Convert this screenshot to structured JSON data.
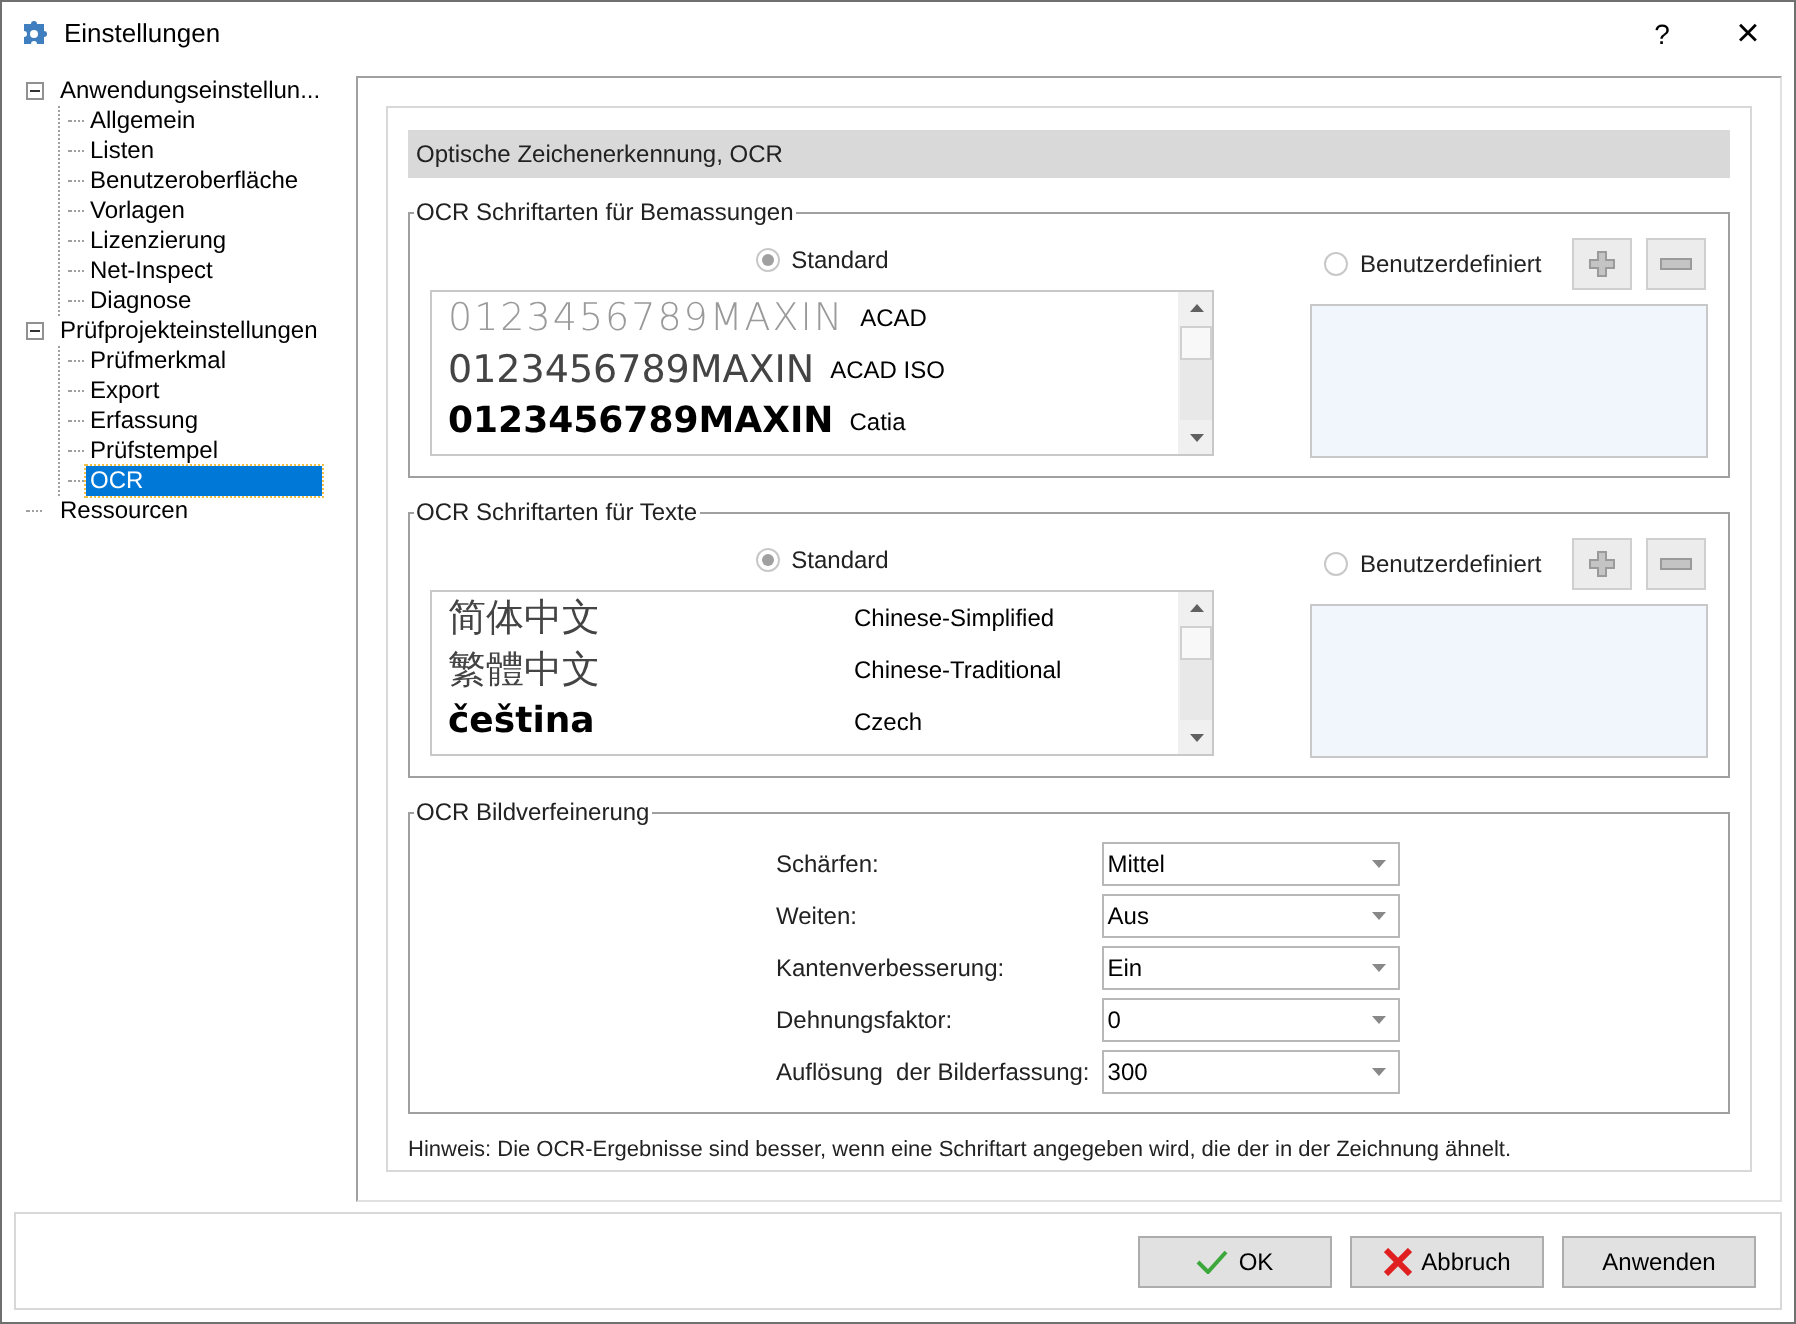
{
  "window": {
    "title": "Einstellungen",
    "help": "?",
    "close": "×"
  },
  "tree": [
    {
      "label": "Anwendungseinstellun...",
      "expanded": true,
      "selected": false,
      "children": [
        {
          "label": "Allgemein",
          "selected": false
        },
        {
          "label": "Listen",
          "selected": false
        },
        {
          "label": "Benutzeroberfläche",
          "selected": false
        },
        {
          "label": "Vorlagen",
          "selected": false
        },
        {
          "label": "Lizenzierung",
          "selected": false
        },
        {
          "label": "Net-Inspect",
          "selected": false
        },
        {
          "label": "Diagnose",
          "selected": false
        }
      ]
    },
    {
      "label": "Prüfprojekteinstellungen",
      "expanded": true,
      "selected": false,
      "children": [
        {
          "label": "Prüfmerkmal",
          "selected": false
        },
        {
          "label": "Export",
          "selected": false
        },
        {
          "label": "Erfassung",
          "selected": false
        },
        {
          "label": "Prüfstempel",
          "selected": false
        },
        {
          "label": "OCR",
          "selected": true
        }
      ]
    },
    {
      "label": "Ressourcen",
      "selected": false
    }
  ],
  "header": "Optische Zeichenerkennung, OCR",
  "font_groups": [
    {
      "title": "OCR Schriftarten für Bemassungen",
      "options": [
        {
          "label": "Standard",
          "selected": true,
          "disabled": true
        },
        {
          "label": "Benutzerdefiniert",
          "selected": false,
          "disabled": true
        }
      ],
      "rows": [
        {
          "sample": "0123456789MAXIN",
          "name": "ACAD",
          "kind": "light"
        },
        {
          "sample": "0123456789MAXIN",
          "name": "ACAD ISO",
          "kind": "regular"
        },
        {
          "sample": "0123456789MAXIN",
          "name": "Catia",
          "kind": "bold"
        }
      ]
    },
    {
      "title": "OCR Schriftarten für Texte",
      "options": [
        {
          "label": "Standard",
          "selected": true,
          "disabled": true
        },
        {
          "label": "Benutzerdefiniert",
          "selected": false,
          "disabled": true
        }
      ],
      "rows": [
        {
          "sample": "简体中文",
          "name": "Chinese-Simplified",
          "kind": "regular"
        },
        {
          "sample": "繁體中文",
          "name": "Chinese-Traditional",
          "kind": "regular"
        },
        {
          "sample": "čeština",
          "name": "Czech",
          "kind": "bold"
        }
      ]
    }
  ],
  "refinement": {
    "title": "OCR Bildverfeinerung",
    "fields": [
      {
        "label": "Schärfen:",
        "value": "Mittel"
      },
      {
        "label": "Weiten:",
        "value": "Aus"
      },
      {
        "label": "Kantenverbesserung:",
        "value": "Ein"
      },
      {
        "label": "Dehnungsfaktor:",
        "value": "0"
      },
      {
        "label": "Auflösung  der Bilderfassung:",
        "value": "300"
      }
    ]
  },
  "hint": "Hinweis: Die OCR-Ergebnisse sind besser, wenn eine Schriftart angegeben wird, die der in der Zeichnung ähnelt.",
  "buttons": [
    {
      "label": "OK",
      "kind": "ok"
    },
    {
      "label": "Abbruch",
      "kind": "cancel"
    },
    {
      "label": "Anwenden",
      "kind": "plain"
    }
  ]
}
